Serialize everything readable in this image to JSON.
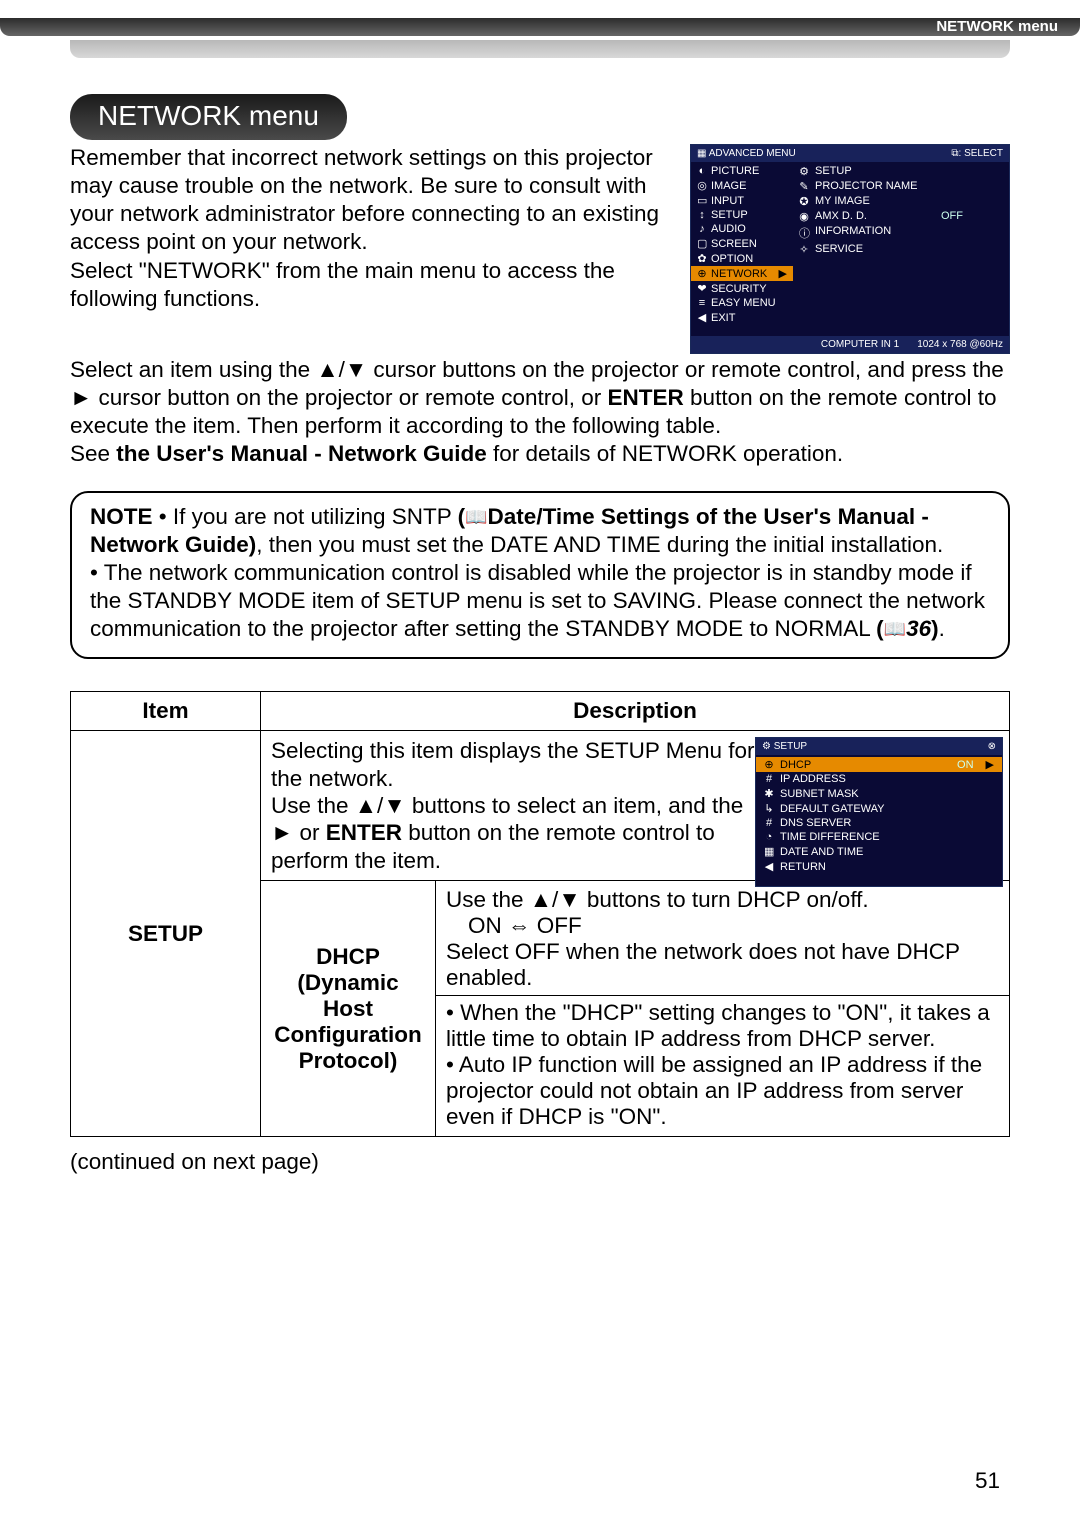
{
  "header": {
    "label": "NETWORK menu"
  },
  "title": "NETWORK menu",
  "intro": {
    "p1": "Remember that incorrect network settings on this projector may cause trouble on the network. Be sure to consult with your network administrator before connecting to an existing access point on your network.",
    "p2": "Select \"NETWORK\" from the main menu to access the following functions."
  },
  "osd_main": {
    "header_left": "ADVANCED MENU",
    "header_right": "⧉: SELECT",
    "left_items": [
      "PICTURE",
      "IMAGE",
      "INPUT",
      "SETUP",
      "AUDIO",
      "SCREEN",
      "OPTION",
      "NETWORK",
      "SECURITY",
      "EASY MENU",
      "EXIT"
    ],
    "selected_left_index": 7,
    "right_items": [
      {
        "label": "SETUP"
      },
      {
        "label": "PROJECTOR NAME"
      },
      {
        "label": "MY IMAGE"
      },
      {
        "label": "AMX D. D.",
        "value": "OFF"
      },
      {
        "label": "INFORMATION"
      },
      {
        "label": "SERVICE"
      }
    ],
    "footer_left": "COMPUTER IN 1",
    "footer_right": "1024 x 768 @60Hz"
  },
  "para2": {
    "line1_a": "Select an item using the ▲/▼ cursor buttons on the projector or remote control, and press the ► cursor button on the projector or remote control, or ",
    "line1_b": "ENTER",
    "line1_c": " button on the remote control to execute the item. Then perform it according to the following table.",
    "line2_a": "See ",
    "line2_b": "the User's Manual - Network Guide",
    "line2_c": " for details of NETWORK operation."
  },
  "note": {
    "label": "NOTE",
    "bullet1_a": " • If you are not utilizing SNTP ",
    "bullet1_ref": "Date/Time Settings of the User's Manual - Network Guide",
    "bullet1_b": ", then you must set the DATE AND TIME during the initial installation.",
    "bullet2": "• The network communication control is disabled while the projector is in standby mode if the STANDBY MODE item of SETUP menu is set to SAVING. Please connect the network communication to the projector after setting the STANDBY MODE to NORMAL ",
    "bullet2_ref": "36",
    "bullet2_end": "."
  },
  "table": {
    "head_item": "Item",
    "head_desc": "Description",
    "setup_label": "SETUP",
    "setup_desc_a": "Selecting this item displays the SETUP Menu for the network.",
    "setup_desc_b": "Use the ▲/▼ buttons to select an item, and the ► or ",
    "setup_desc_enter": "ENTER",
    "setup_desc_c": " button on the remote control to perform the item.",
    "dhcp_label_a": "DHCP",
    "dhcp_label_b": "(Dynamic Host Configuration Protocol)",
    "dhcp_desc_a": "Use the ▲/▼ buttons to turn DHCP on/off.",
    "dhcp_desc_b": "ON ⇔ OFF",
    "dhcp_desc_c": "Select OFF when the network does not have DHCP enabled.",
    "dhcp_desc_d": "• When the \"DHCP\" setting changes to \"ON\", it takes a little time to obtain IP address from DHCP server.",
    "dhcp_desc_e": "• Auto IP function will be assigned an IP address if the projector could not obtain an IP address from server even if DHCP is \"ON\"."
  },
  "setup_osd": {
    "header_left": "SETUP",
    "header_right": "⊗",
    "items": [
      {
        "label": "DHCP",
        "value": "ON",
        "sel": true
      },
      {
        "label": "IP ADDRESS"
      },
      {
        "label": "SUBNET MASK"
      },
      {
        "label": "DEFAULT GATEWAY"
      },
      {
        "label": "DNS SERVER"
      },
      {
        "label": "TIME DIFFERENCE"
      },
      {
        "label": "DATE AND TIME"
      },
      {
        "label": "RETURN",
        "ret": true
      }
    ]
  },
  "continued": "(continued on next page)",
  "page_number": "51"
}
